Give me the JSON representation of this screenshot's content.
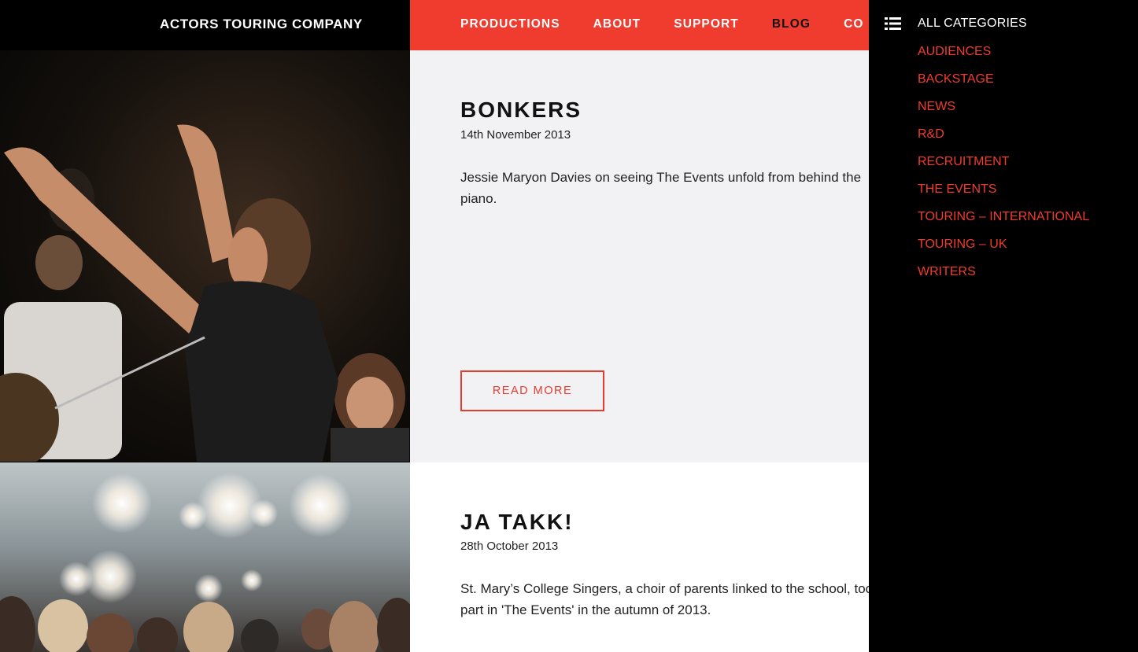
{
  "brand": {
    "name": "ACTORS TOURING COMPANY"
  },
  "nav": {
    "items": [
      {
        "label": "PRODUCTIONS"
      },
      {
        "label": "ABOUT"
      },
      {
        "label": "SUPPORT"
      },
      {
        "label": "BLOG"
      },
      {
        "label": "CO"
      }
    ],
    "active": "BLOG"
  },
  "posts": [
    {
      "title": "BONKERS",
      "date": "14th November 2013",
      "excerpt": "Jessie Maryon Davies on seeing The Events unfold from behind the piano.",
      "read_more": "READ MORE"
    },
    {
      "title": "JA TAKK!",
      "date": "28th October 2013",
      "excerpt": "St. Mary’s College Singers, a choir of parents linked to the school, took part in 'The Events' in the autumn of 2013."
    }
  ],
  "categories": {
    "all_label": "ALL CATEGORIES",
    "icon": "list-icon",
    "items": [
      "AUDIENCES",
      "BACKSTAGE",
      "NEWS",
      "R&D",
      "RECRUITMENT",
      "THE EVENTS",
      "TOURING – INTERNATIONAL",
      "TOURING – UK",
      "WRITERS"
    ]
  },
  "colors": {
    "accent": "#f03c2e",
    "nav_active": "#111111",
    "panel_bg": "#000000",
    "post_bg_alt": "#f2f2f4"
  }
}
